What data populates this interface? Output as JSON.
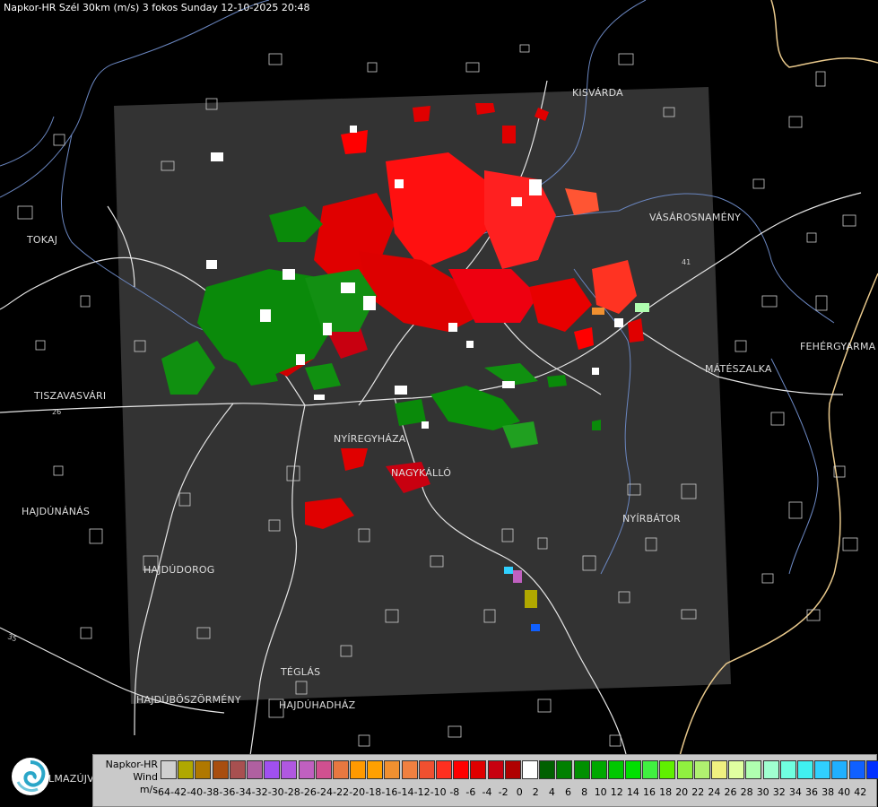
{
  "header": {
    "title": "Napkor-HR Szél 30km (m/s) 3 fokos Sunday 12-10-2025 20:48"
  },
  "cities": [
    {
      "id": "kisvarda",
      "name": "KISVÁRDA"
    },
    {
      "id": "tokaj",
      "name": "TOKAJ"
    },
    {
      "id": "vasarosnameny",
      "name": "VÁSÁROSNAMÉNY"
    },
    {
      "id": "fehergyarmat",
      "name": "FEHÉRGYARMA"
    },
    {
      "id": "mateszalka",
      "name": "MÁTÉSZALKA"
    },
    {
      "id": "tiszavasvari",
      "name": "TISZAVASVÁRI"
    },
    {
      "id": "nyiregyhaza",
      "name": "NYÍREGYHÁZA"
    },
    {
      "id": "nagykallo",
      "name": "NAGYKÁLLÓ"
    },
    {
      "id": "hajdunanas",
      "name": "HAJDÚNÁNÁS"
    },
    {
      "id": "nyirbator",
      "name": "NYÍRBÁTOR"
    },
    {
      "id": "hajdudorog",
      "name": "HAJDÚDOROG"
    },
    {
      "id": "teglas",
      "name": "TÉGLÁS"
    },
    {
      "id": "hajduboszormeny",
      "name": "HAJDÚBÖSZÖRMÉNY"
    },
    {
      "id": "hajduhadhaz",
      "name": "HAJDÚHADHÁZ"
    },
    {
      "id": "balmazujvaros",
      "name": "LMAZÚJVÁR"
    }
  ],
  "roads": [
    "26",
    "35",
    "41"
  ],
  "legend": {
    "title_lines": [
      "Napkor-HR",
      "Wind",
      "m/s"
    ],
    "labels": [
      "-64",
      "-42",
      "-40",
      "-38",
      "-36",
      "-34",
      "-32",
      "-30",
      "-28",
      "-26",
      "-24",
      "-22",
      "-20",
      "-18",
      "-16",
      "-14",
      "-12",
      "-10",
      "-8",
      "-6",
      "-4",
      "-2",
      "0",
      "2",
      "4",
      "6",
      "8",
      "10",
      "12",
      "14",
      "16",
      "18",
      "20",
      "22",
      "24",
      "26",
      "28",
      "30",
      "32",
      "34",
      "36",
      "38",
      "40",
      "42"
    ],
    "colors": [
      "#d0d0d0",
      "#b0a800",
      "#b07800",
      "#a84e10",
      "#a85050",
      "#b060a0",
      "#a050f0",
      "#b058e0",
      "#c060c0",
      "#d05090",
      "#e87840",
      "#ff9a00",
      "#ffa000",
      "#f09030",
      "#f08040",
      "#f05030",
      "#ff3020",
      "#ff0000",
      "#e00000",
      "#c80010",
      "#b00000",
      "#ffffff",
      "#006000",
      "#008000",
      "#009000",
      "#00a800",
      "#00c800",
      "#00e000",
      "#40f040",
      "#60f000",
      "#90f040",
      "#b0f070",
      "#f0f080",
      "#e0ffa0",
      "#b0ffb0",
      "#a0ffd0",
      "#70ffe0",
      "#40f0f0",
      "#30d0ff",
      "#20b0ff",
      "#1060ff",
      "#0030ff",
      "#0000e0"
    ]
  }
}
